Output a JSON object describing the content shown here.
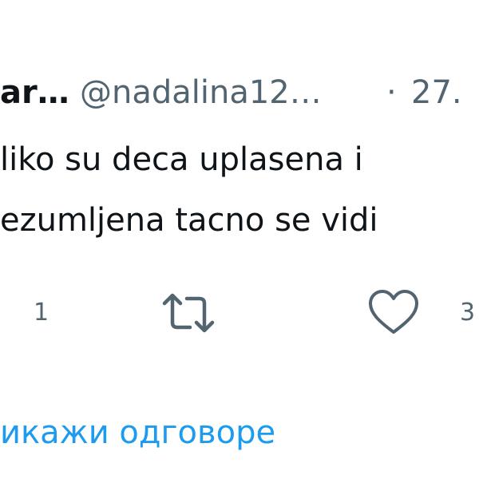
{
  "tweet": {
    "display_name": "ar…",
    "handle": "@nadalina12…",
    "separator": "·",
    "date": "27.",
    "text_lines": [
      "liko su deca uplasena i",
      "ezumljena tacno se vidi"
    ]
  },
  "actions": {
    "reply": {
      "icon": "reply-icon",
      "count": "1"
    },
    "retweet": {
      "icon": "retweet-icon",
      "count": ""
    },
    "like": {
      "icon": "heart-icon",
      "count": "3"
    }
  },
  "show_replies": {
    "label": "икажи одговоре"
  },
  "colors": {
    "text": "#0f1419",
    "secondary": "#536471",
    "link": "#1d9bf0"
  }
}
